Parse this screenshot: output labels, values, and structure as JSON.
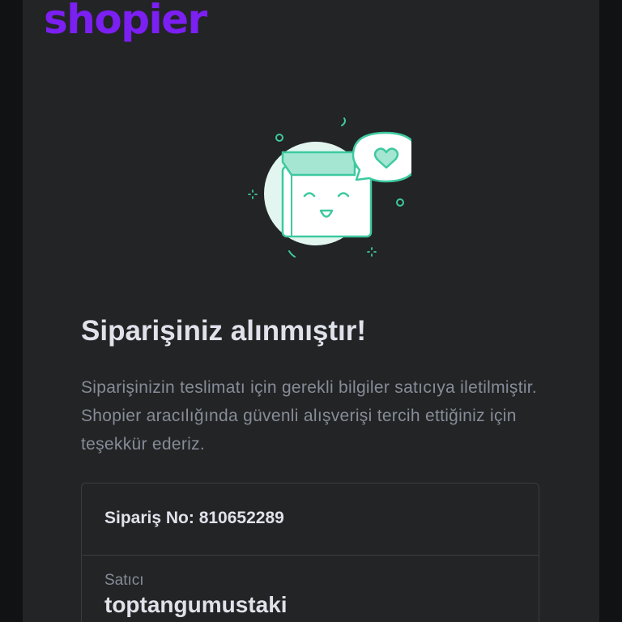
{
  "brand": {
    "logo_text": "shopier",
    "accent_color": "#7b1ff2"
  },
  "illustration": {
    "icon": "happy-box-with-heart-bubble-icon",
    "color": "#3ec9a0"
  },
  "confirmation": {
    "title": "Siparişiniz alınmıştır!",
    "description": "Siparişinizin teslimatı için gerekli bilgiler satıcıya iletilmiştir. Shopier aracılığında güvenli alışverişi tercih ettiğiniz için teşekkür ederiz."
  },
  "order": {
    "number_label": "Sipariş No:",
    "number": "810652289",
    "seller_label": "Satıcı",
    "seller_name": "toptangumustaki"
  }
}
